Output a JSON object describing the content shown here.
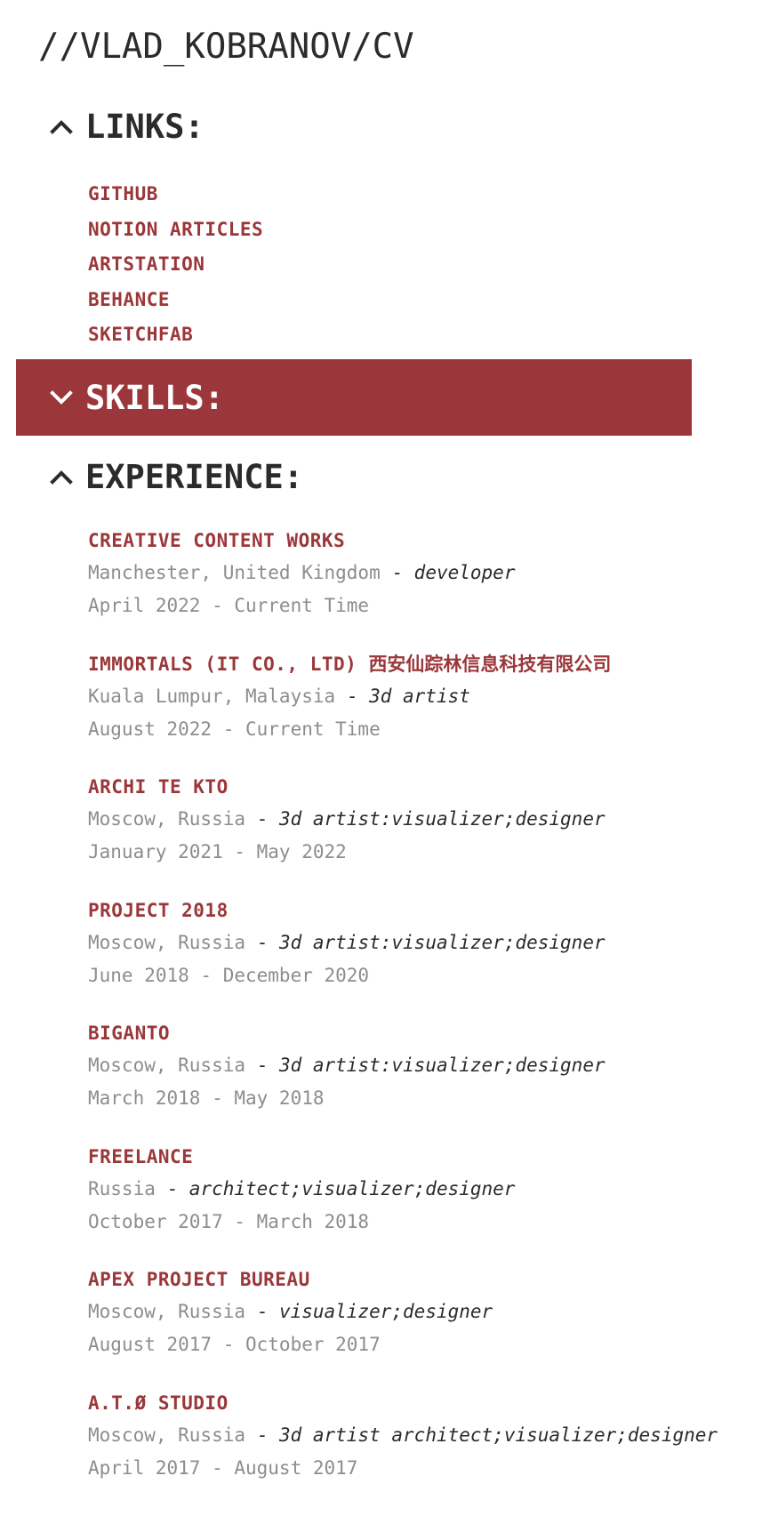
{
  "header": {
    "title": "//VLAD_KOBRANOV/CV"
  },
  "sections": {
    "links": {
      "label": "LINKS:",
      "state": "expanded"
    },
    "skills": {
      "label": "SKILLS:",
      "state": "collapsed"
    },
    "experience": {
      "label": "EXPERIENCE:",
      "state": "expanded"
    }
  },
  "links": [
    {
      "label": "GITHUB"
    },
    {
      "label": "NOTION ARTICLES"
    },
    {
      "label": "ARTSTATION"
    },
    {
      "label": "BEHANCE"
    },
    {
      "label": "SKETCHFAB"
    }
  ],
  "experience": [
    {
      "company": "CREATIVE CONTENT WORKS",
      "company_extra": "",
      "location": "Manchester, United Kingdom",
      "separator": " - ",
      "role": "developer",
      "dates": "April 2022 - Current Time"
    },
    {
      "company": "IMMORTALS (IT CO., LTD) ",
      "company_extra": "西安仙踪林信息科技有限公司",
      "location": "Kuala Lumpur, Malaysia",
      "separator": " - ",
      "role": "3d artist",
      "dates": "August 2022 - Current Time"
    },
    {
      "company": "ARCHI TE KTO",
      "company_extra": "",
      "location": "Moscow, Russia",
      "separator": " - ",
      "role": "3d artist:visualizer;designer",
      "dates": "January 2021 - May 2022"
    },
    {
      "company": "PROJECT 2018",
      "company_extra": "",
      "location": "Moscow, Russia",
      "separator": " - ",
      "role": "3d artist:visualizer;designer",
      "dates": "June 2018 - December 2020"
    },
    {
      "company": "BIGANTO",
      "company_extra": "",
      "location": "Moscow, Russia",
      "separator": " - ",
      "role": "3d artist:visualizer;designer",
      "dates": "March 2018 - May 2018"
    },
    {
      "company": "FREELANCE",
      "company_extra": "",
      "location": "Russia",
      "separator": " - ",
      "role": "architect;visualizer;designer",
      "dates": "October 2017 - March 2018"
    },
    {
      "company": "APEX PROJECT BUREAU",
      "company_extra": "",
      "location": "Moscow, Russia",
      "separator": " - ",
      "role": "visualizer;designer",
      "dates": "August 2017 - October 2017"
    },
    {
      "company": "A.T.Ø STUDIO",
      "company_extra": "",
      "location": "Moscow, Russia",
      "separator": " - ",
      "role": "3d artist architect;visualizer;designer",
      "dates": "April 2017 - August 2017"
    }
  ],
  "icons": {
    "expanded": "chevron-up-icon",
    "collapsed": "chevron-down-icon"
  },
  "colors": {
    "accent": "#9b373a",
    "text": "#2b2b2b",
    "muted": "#8d8d8d",
    "background": "#ffffff"
  }
}
